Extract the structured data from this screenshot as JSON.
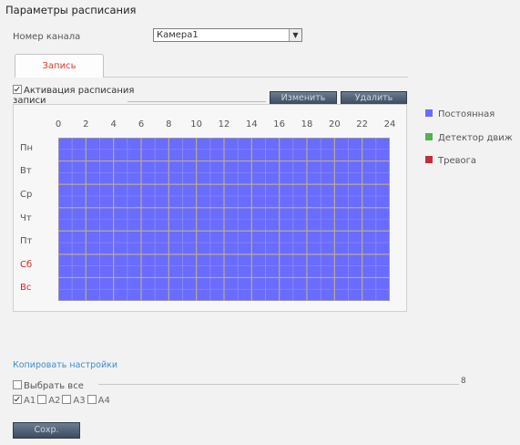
{
  "title": "Параметры расписания",
  "channel": {
    "label": "Номер канала",
    "value": "Камера1"
  },
  "tabs": [
    {
      "label": "Запись",
      "active": true
    }
  ],
  "activation": {
    "label": "Активация расписания записи",
    "checked": true
  },
  "buttons": {
    "edit": "Изменить",
    "delete": "Удалить",
    "save": "Сохр."
  },
  "hours": [
    "0",
    "2",
    "4",
    "6",
    "8",
    "10",
    "12",
    "14",
    "16",
    "18",
    "20",
    "22",
    "24"
  ],
  "days": [
    {
      "label": "Пн",
      "weekend": false
    },
    {
      "label": "Вт",
      "weekend": false
    },
    {
      "label": "Ср",
      "weekend": false
    },
    {
      "label": "Чт",
      "weekend": false
    },
    {
      "label": "Пт",
      "weekend": false
    },
    {
      "label": "Сб",
      "weekend": true
    },
    {
      "label": "Вс",
      "weekend": true
    }
  ],
  "schedule": {
    "all_days_all_hours": "Постоянная"
  },
  "legend": [
    {
      "label": "Постоянная",
      "color": "#6a6bff"
    },
    {
      "label": "Детектор движ",
      "color": "#55b050"
    },
    {
      "label": "Тревога",
      "color": "#c0303a"
    }
  ],
  "copy": {
    "link": "Копировать настройки",
    "select_all": "Выбрать все",
    "select_mark": "8",
    "channels": [
      {
        "label": "A1",
        "checked": true
      },
      {
        "label": "A2",
        "checked": false
      },
      {
        "label": "A3",
        "checked": false
      },
      {
        "label": "A4",
        "checked": false
      }
    ]
  },
  "colors": {
    "accent_tab": "#e8392d",
    "weekend": "#e0201a",
    "link": "#3b8fd0"
  }
}
